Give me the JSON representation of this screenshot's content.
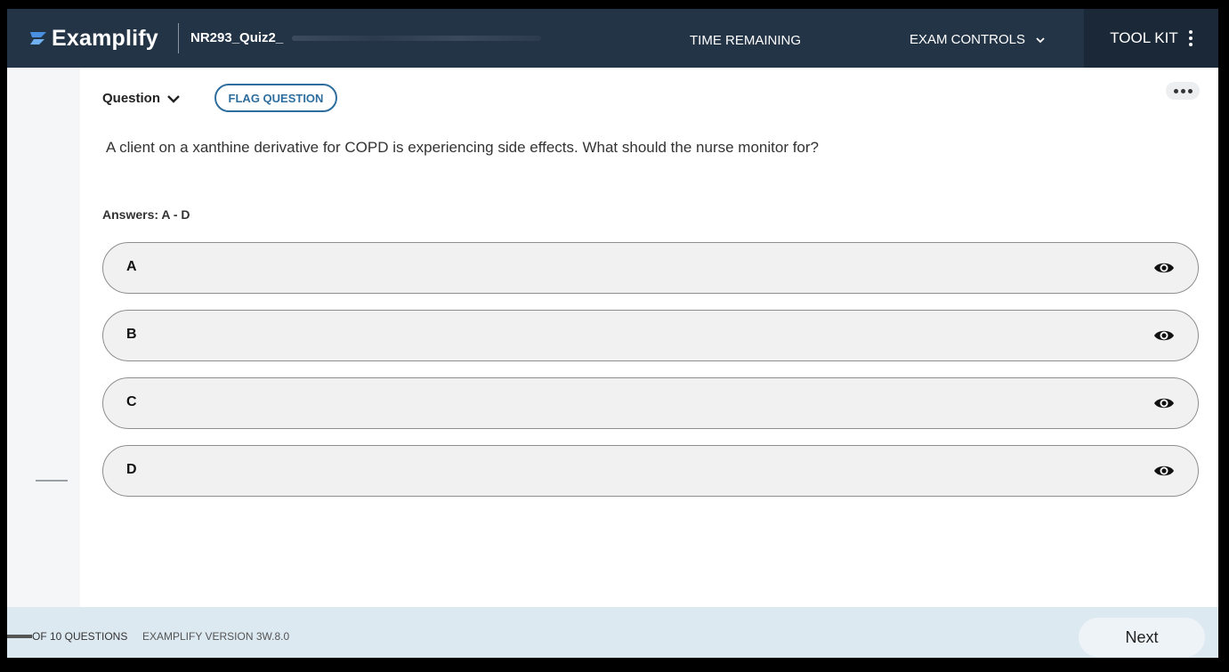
{
  "header": {
    "logo_text": "Examplify",
    "exam_name": "NR293_Quiz2_",
    "time_remaining_label": "TIME REMAINING",
    "exam_controls_label": "EXAM CONTROLS",
    "toolkit_label": "TOOL KIT"
  },
  "question": {
    "selector_label": "Question",
    "flag_label": "FLAG QUESTION",
    "text": "A client on a xanthine derivative for COPD is experiencing side effects. What should the nurse monitor for?",
    "answers_label": "Answers: A - D",
    "options": [
      {
        "letter": "A"
      },
      {
        "letter": "B"
      },
      {
        "letter": "C"
      },
      {
        "letter": "D"
      }
    ]
  },
  "footer": {
    "count_label": "OF 10 QUESTIONS",
    "version_label": "EXAMPLIFY VERSION 3W.8.0",
    "next_label": "Next"
  },
  "colors": {
    "header_bg": "#243447",
    "toolkit_bg": "#1b2838",
    "accent": "#2d6e9e",
    "footer_bg": "#dde9f1",
    "logo_mark": "#4a90e2"
  },
  "icons": [
    "examplify-logo-icon",
    "chevron-down-icon",
    "kebab-menu-icon",
    "more-horizontal-icon",
    "eye-icon"
  ]
}
